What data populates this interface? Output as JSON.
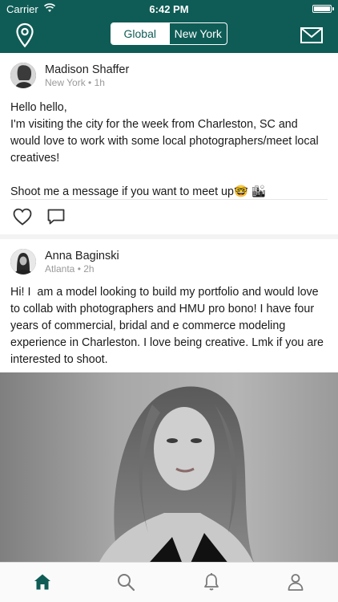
{
  "status_bar": {
    "carrier": "Carrier",
    "time": "6:42 PM",
    "battery_level": 1.0
  },
  "header": {
    "location_icon": "map-pin-icon",
    "segments": [
      {
        "label": "Global",
        "selected": true
      },
      {
        "label": "New York",
        "selected": false
      }
    ],
    "messages_icon": "mail-icon",
    "background_color": "#0f5c56"
  },
  "posts": [
    {
      "author": "Madison Shaffer",
      "location": "New York",
      "time_ago": "1h",
      "body": "Hello hello,\nI'm visiting the city for the week from Charleston, SC and would love to work with some local photographers/meet local creatives!\n\nShoot me a message if you want to meet up🤓 🏙",
      "actions": [
        "heart-icon",
        "comment-icon"
      ]
    },
    {
      "author": "Anna Baginski",
      "location": "Atlanta",
      "time_ago": "2h",
      "body": "Hi! I  am a model looking to build my portfolio and would love to collab with photographers and HMU pro bono! I have four years of commercial, bridal and e commerce modeling experience in Charleston. I love being creative. Lmk if you are interested to shoot.",
      "has_photo": true
    }
  ],
  "meta_separator": "•",
  "tab_bar": {
    "tabs": [
      {
        "icon": "home-icon",
        "selected": true
      },
      {
        "icon": "search-icon",
        "selected": false
      },
      {
        "icon": "bell-icon",
        "selected": false
      },
      {
        "icon": "profile-icon",
        "selected": false
      }
    ]
  }
}
